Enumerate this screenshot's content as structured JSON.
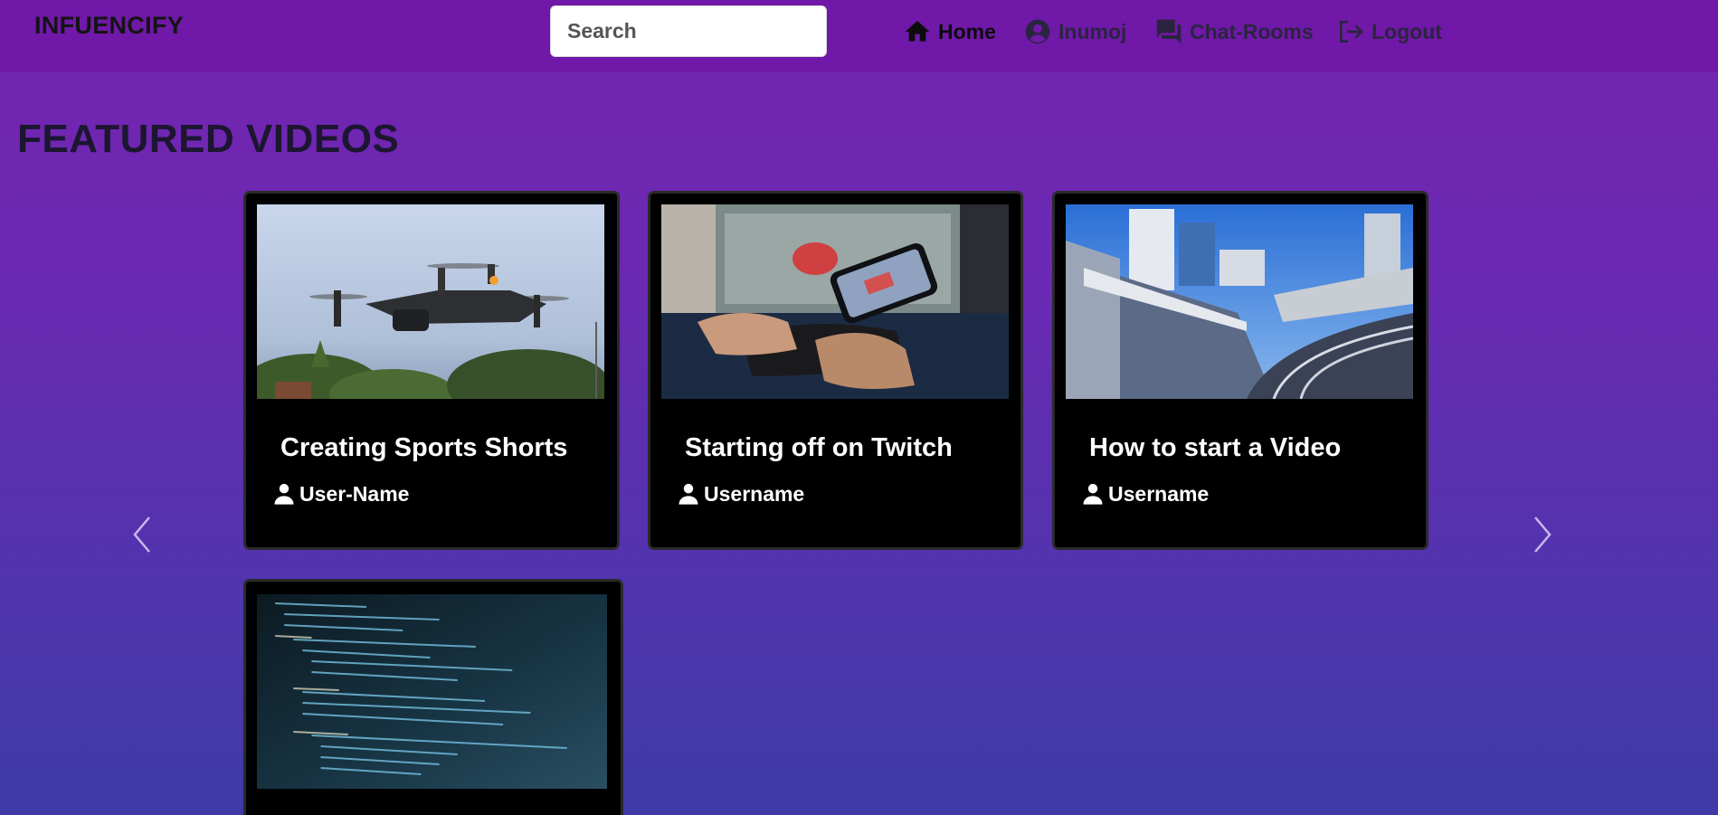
{
  "navbar": {
    "brand": "INFUENCIFY",
    "search_placeholder": "Search",
    "links": {
      "home": "Home",
      "profile": "Inumoj",
      "chat": "Chat-Rooms",
      "logout": "Logout"
    },
    "active": "home"
  },
  "section": {
    "title": "FEATURED VIDEOS"
  },
  "videos": [
    {
      "title": "Creating Sports Shorts",
      "author": "User-Name",
      "thumbnail": "drone-photo"
    },
    {
      "title": "Starting off on Twitch",
      "author": "Username",
      "thumbnail": "gaming-controller-photo"
    },
    {
      "title": "How to start a Video",
      "author": "Username",
      "thumbnail": "railway-city-photo"
    },
    {
      "title": "",
      "author": "",
      "thumbnail": "code-screen-photo"
    }
  ],
  "carousel": {
    "prev_icon": "chevron-left-icon",
    "next_icon": "chevron-right-icon"
  },
  "colors": {
    "navbar": "#7018a8",
    "background_top": "#7424b0",
    "background_bottom": "#3f3aa8",
    "card": "#000000",
    "card_text": "#ffffff"
  }
}
